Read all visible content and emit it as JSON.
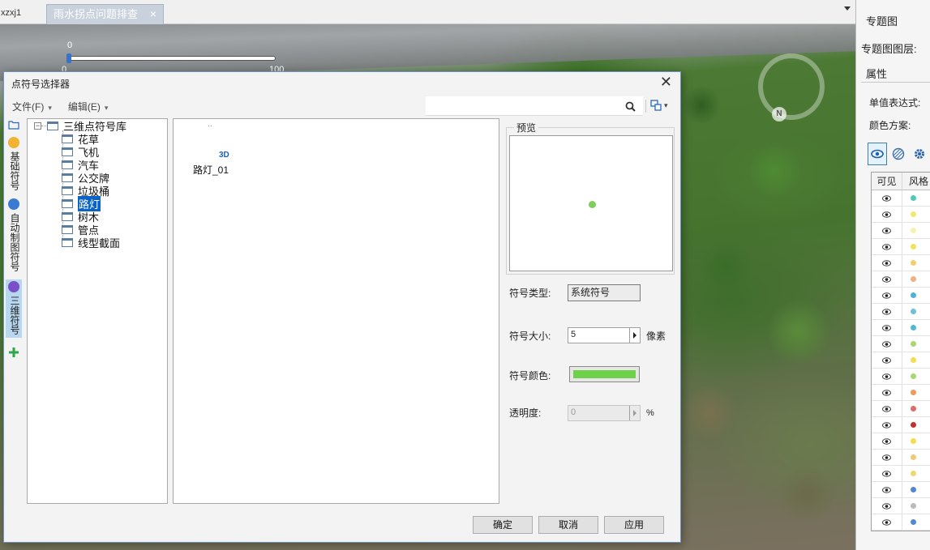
{
  "tabs": {
    "prev_label": "xzxj1",
    "active_label": "雨水拐点问题排查",
    "close_glyph": "×"
  },
  "map": {
    "scale_top_label": "0",
    "scale_left_label": "0",
    "scale_right_label": "100",
    "compass_label": "N"
  },
  "right_panel": {
    "title": "专题图",
    "layer_label": "专题图图层:",
    "tab_label": "属性",
    "expr_label": "单值表达式:",
    "color_scheme_label": "颜色方案:",
    "toolbar_icons": [
      "eye-icon",
      "hatch-icon",
      "gear-icon"
    ],
    "table_headers": [
      "可见",
      "风格"
    ],
    "rows": [
      {
        "color": "#4fc9b8"
      },
      {
        "color": "#f2e86a"
      },
      {
        "color": "#f7f2b0"
      },
      {
        "color": "#f0e25a"
      },
      {
        "color": "#f2d06a"
      },
      {
        "color": "#f0b080"
      },
      {
        "color": "#4fb0d8"
      },
      {
        "color": "#6fc0d8"
      },
      {
        "color": "#4fb8d0"
      },
      {
        "color": "#a8d870"
      },
      {
        "color": "#f0e050"
      },
      {
        "color": "#a8d870"
      },
      {
        "color": "#f09a5a"
      },
      {
        "color": "#e06a6a"
      },
      {
        "color": "#c03030"
      },
      {
        "color": "#f0e050"
      },
      {
        "color": "#f0c878"
      },
      {
        "color": "#f0d870"
      },
      {
        "color": "#4f8ad0"
      },
      {
        "color": "#bbbbbb"
      },
      {
        "color": "#4f8ad0"
      }
    ]
  },
  "dialog": {
    "title": "点符号选择器",
    "close_glyph": "✕",
    "menu": [
      {
        "label": "文件(F)"
      },
      {
        "label": "编辑(E)"
      }
    ],
    "side_tabs": [
      {
        "label": "基础符号",
        "icon": "basic-symbol-icon"
      },
      {
        "label": "自动制图符号",
        "icon": "auto-map-symbol-icon"
      },
      {
        "label": "三维符号",
        "icon": "3d-symbol-icon"
      }
    ],
    "tree": {
      "root": "三维点符号库",
      "children": [
        "花草",
        "飞机",
        "汽车",
        "公交牌",
        "垃圾桶",
        "路灯",
        "树木",
        "管点",
        "线型截面"
      ],
      "selected": "路灯"
    },
    "symbols": [
      {
        "badge": "3D",
        "name": "路灯_01"
      }
    ],
    "preview_label": "预览",
    "preview_dot_color": "#7dcf5a",
    "props": {
      "type_label": "符号类型:",
      "type_value": "系统符号",
      "size_label": "符号大小:",
      "size_value": "5",
      "size_unit": "像素",
      "color_label": "符号颜色:",
      "color_value": "#6fd04a",
      "opacity_label": "透明度:",
      "opacity_value": "0",
      "opacity_unit": "%"
    },
    "buttons": {
      "ok": "确定",
      "cancel": "取消",
      "apply": "应用"
    }
  }
}
